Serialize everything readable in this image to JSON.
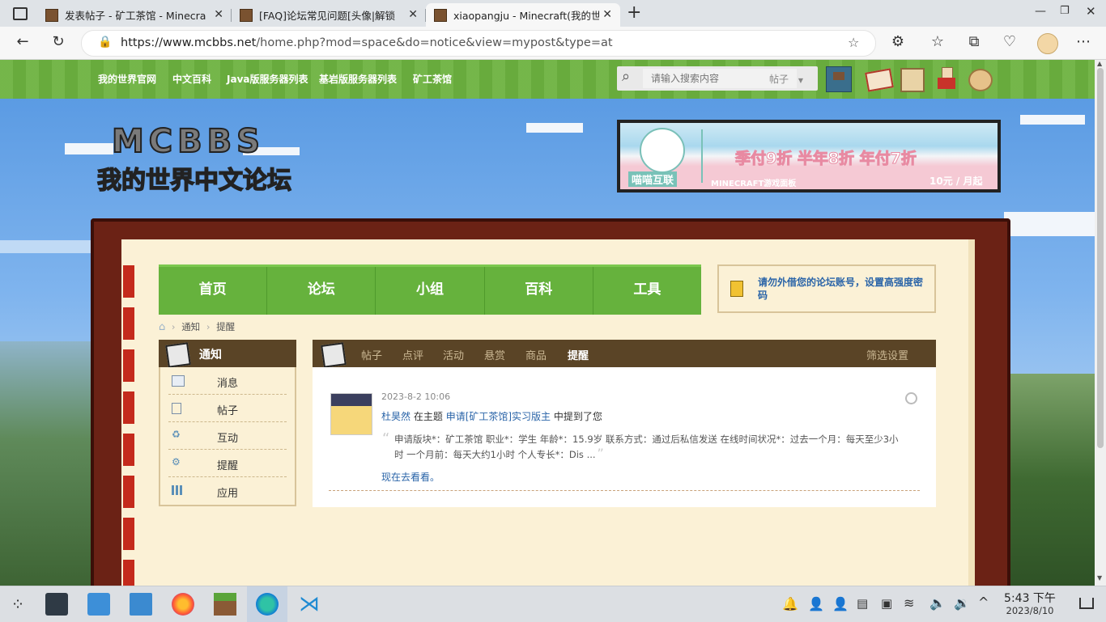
{
  "browser": {
    "tabs": [
      {
        "title": "发表帖子 - 矿工茶馆 - Minecra",
        "active": false
      },
      {
        "title": "[FAQ]论坛常见问题[头像|解锁",
        "active": false
      },
      {
        "title": "xiaopangju - Minecraft(我的世",
        "active": true
      }
    ],
    "new_tab": "+",
    "url_host": "https://www.mcbbs.net",
    "url_path": "/home.php?mod=space&do=notice&view=mypost&type=at"
  },
  "site": {
    "topnav": [
      "我的世界官网",
      "中文百科",
      "Java版服务器列表",
      "基岩版服务器列表",
      "矿工茶馆"
    ],
    "search_placeholder": "请输入搜索内容",
    "search_scope": "帖子",
    "logo_top": "MCBBS",
    "logo_bottom": "我的世界中文论坛",
    "ad": {
      "brand": "喵喵互联",
      "headline": "季付9折 半年8折 年付7折",
      "sub": "MINECRAFT游戏面板",
      "price": "10元 / 月起"
    },
    "mainnav": [
      "首页",
      "论坛",
      "小组",
      "百科",
      "工具"
    ],
    "notice_text": "请勿外借您的论坛账号，设置高强度密码",
    "breadcrumb": [
      "通知",
      "提醒"
    ],
    "left_menu": {
      "title": "通知",
      "items": [
        "消息",
        "帖子",
        "互动",
        "提醒",
        "应用"
      ]
    },
    "content_tabs": [
      "帖子",
      "点评",
      "活动",
      "悬赏",
      "商品",
      "提醒"
    ],
    "filter_label": "筛选设置",
    "notification": {
      "time": "2023-8-2 10:06",
      "user": "杜昊然",
      "pre": "在主题",
      "thread": "申请[矿工茶馆]实习版主",
      "post": "中提到了您",
      "quote_line1": "申请版块*：矿工茶馆 职业*：学生 年龄*：15.9岁 联系方式：通过后私信发送 在线时间状况*：过去一个月：每天至少3小",
      "quote_line2": "时 一个月前：每天大约1小时 个人专长*：Dis ...",
      "link": "现在去看看。"
    }
  },
  "taskbar": {
    "time": "5:43 下午",
    "date": "2023/8/10"
  },
  "colors": {
    "green": "#66b23d",
    "brown": "#5a4426",
    "book": "#6b2215",
    "paper": "#fbf1d6",
    "link": "#2a64a8"
  }
}
